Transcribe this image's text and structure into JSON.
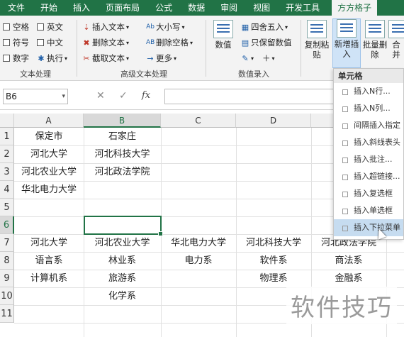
{
  "tabs": [
    "文件",
    "开始",
    "插入",
    "页面布局",
    "公式",
    "数据",
    "审阅",
    "视图",
    "开发工具",
    "方方格子"
  ],
  "active_tab": "方方格子",
  "ribbon": {
    "text_group": {
      "name": "文本处理",
      "checks": [
        "空格",
        "英文",
        "符号",
        "中文",
        "数字"
      ],
      "exec_label": "执行"
    },
    "adv_group": {
      "name": "高级文本处理",
      "col1": [
        "插入文本",
        "删除文本",
        "截取文本"
      ],
      "col2": [
        "大小写",
        "删除空格",
        "更多"
      ]
    },
    "num_group": {
      "name": "数值录入",
      "big": "数值",
      "items": [
        "四舍五入",
        "只保留数值"
      ]
    },
    "buttons": {
      "paste": "复制粘贴",
      "insert_new": "新增插入",
      "batch_delete": "批量删除",
      "merge": "合并"
    }
  },
  "formula_bar": {
    "name_box": "B6",
    "fx": "fx",
    "formula": ""
  },
  "columns": [
    "A",
    "B",
    "C",
    "D"
  ],
  "rows": [
    "1",
    "2",
    "3",
    "4",
    "5",
    "6",
    "7",
    "8",
    "9",
    "10",
    "11"
  ],
  "cells": {
    "A1": "保定市",
    "B1": "石家庄",
    "A2": "河北大学",
    "B2": "河北科技大学",
    "A3": "河北农业大学",
    "B3": "河北政法学院",
    "A4": "华北电力大学",
    "A7": "河北大学",
    "B7": "河北农业大学",
    "C7": "华北电力大学",
    "D7": "河北科技大学",
    "E7": "河北政法学院",
    "A8": "语言系",
    "B8": "林业系",
    "C8": "电力系",
    "D8": "软件系",
    "E8": "商法系",
    "A9": "计算机系",
    "B9": "旅游系",
    "D9": "物理系",
    "E9": "金融系",
    "B10": "化学系"
  },
  "menu": {
    "header": "单元格",
    "items": [
      "插入N行...",
      "插入N列...",
      "间隔插入指定",
      "插入斜线表头",
      "插入批注...",
      "插入超链接...",
      "插入复选框",
      "插入单选框",
      "插入下拉菜单"
    ],
    "hover_index": 8
  },
  "watermark": "软件技巧"
}
